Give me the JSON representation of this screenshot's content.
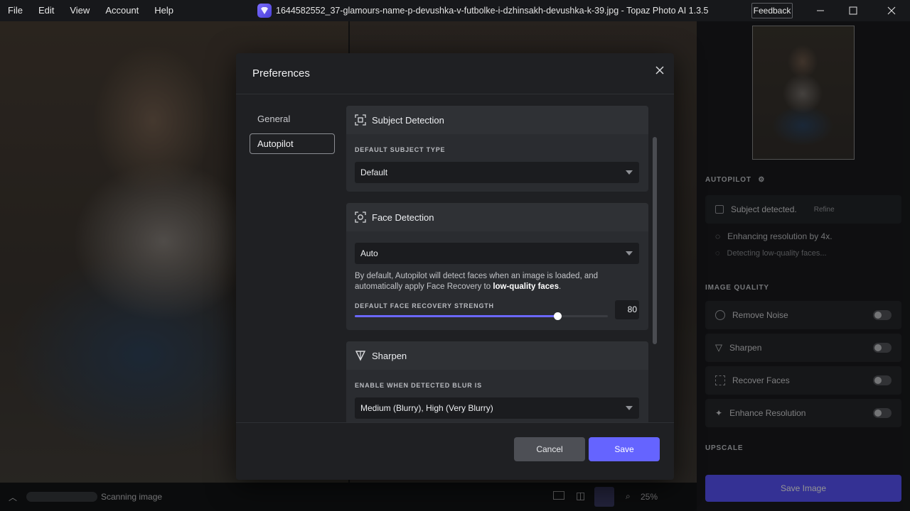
{
  "menu": [
    "File",
    "Edit",
    "View",
    "Account",
    "Help"
  ],
  "window": {
    "title": "1644582552_37-glamours-name-p-devushka-v-futbolke-i-dzhinsakh-devushka-k-39.jpg - Topaz Photo AI 1.3.5",
    "feedback_label": "Feedback"
  },
  "right_panel": {
    "autopilot_title": "AUTOPILOT",
    "subject_detected": "Subject detected.",
    "refine_label": "Refine",
    "enhancing_text": "Enhancing resolution by 4x.",
    "detecting_text": "Detecting low-quality faces...",
    "image_quality_title": "IMAGE QUALITY",
    "items": [
      {
        "label": "Remove Noise",
        "icon": "remove-noise-icon"
      },
      {
        "label": "Sharpen",
        "icon": "sharpen-icon"
      },
      {
        "label": "Recover Faces",
        "icon": "recover-faces-icon"
      },
      {
        "label": "Enhance Resolution",
        "icon": "enhance-resolution-icon"
      }
    ],
    "upscale_title": "UPSCALE",
    "save_image_label": "Save Image"
  },
  "bottom_bar": {
    "status_text": "Scanning image",
    "zoom": "25%"
  },
  "modal": {
    "title": "Preferences",
    "nav": [
      {
        "label": "General",
        "active": false
      },
      {
        "label": "Autopilot",
        "active": true
      }
    ],
    "subject_detection": {
      "title": "Subject Detection",
      "label": "DEFAULT SUBJECT TYPE",
      "value": "Default"
    },
    "face_detection": {
      "title": "Face Detection",
      "value": "Auto",
      "desc_prefix": "By default, Autopilot will detect faces when an image is loaded, and automatically apply Face Recovery to ",
      "desc_bold": "low-quality faces",
      "desc_suffix": ".",
      "strength_label": "DEFAULT FACE RECOVERY STRENGTH",
      "strength_value": "80",
      "strength_fraction": 0.8
    },
    "sharpen": {
      "title": "Sharpen",
      "label": "ENABLE WHEN DETECTED BLUR IS",
      "value": "Medium (Blurry), High (Very Blurry)"
    },
    "cancel_label": "Cancel",
    "save_label": "Save"
  },
  "colors": {
    "accent": "#6564ff",
    "modal_bg": "#1f2023",
    "card_bg": "#2a2c30"
  }
}
